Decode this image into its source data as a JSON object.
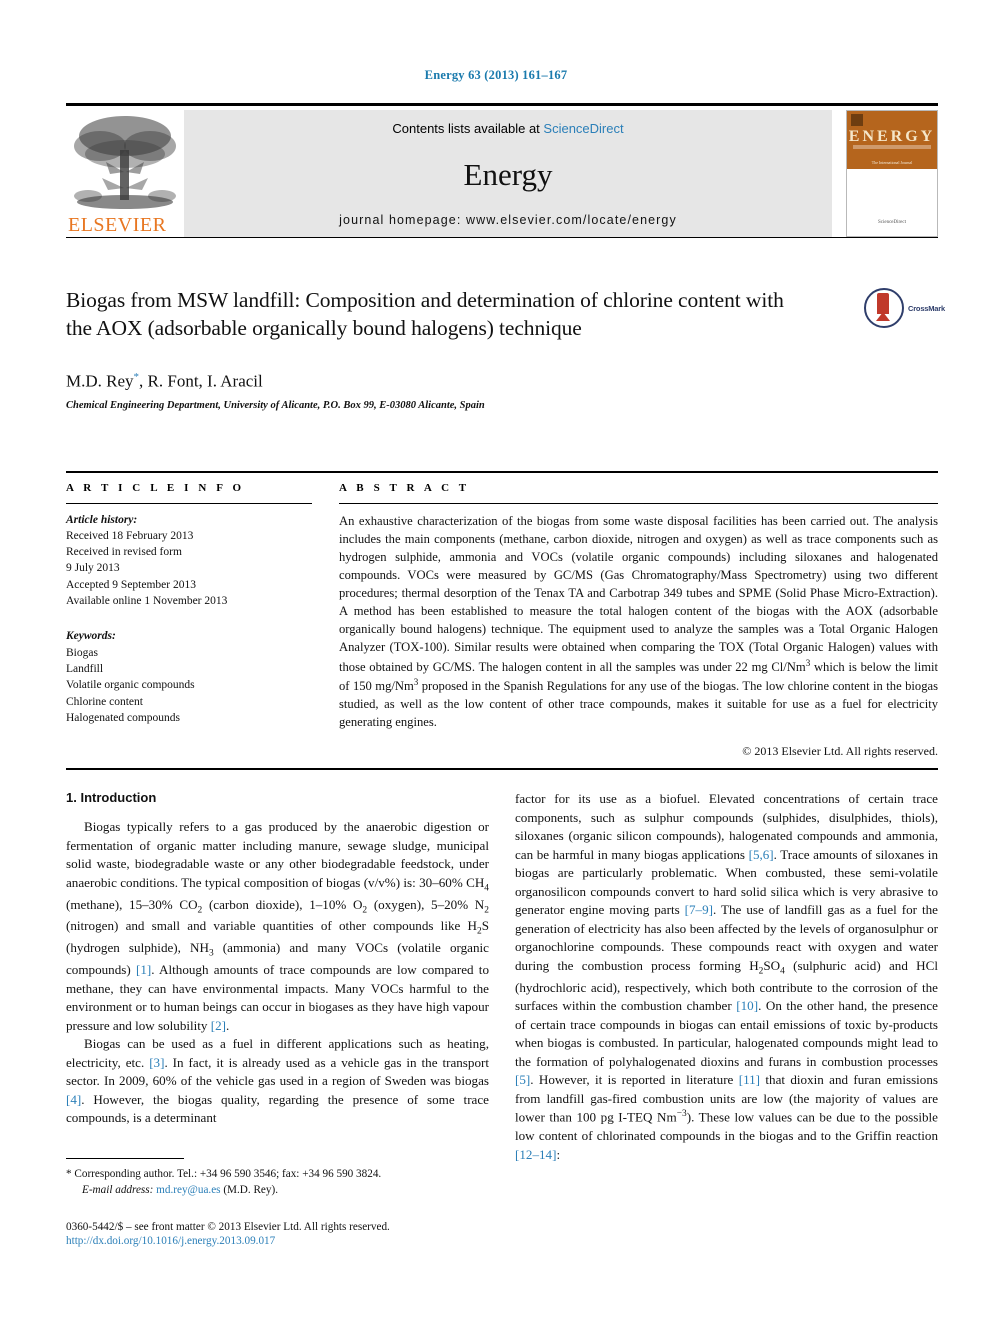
{
  "running_head": "Energy 63 (2013) 161–167",
  "masthead": {
    "contents_prefix": "Contents lists available at ",
    "sciencedirect_link": "ScienceDirect",
    "journal_name": "Energy",
    "homepage": "journal homepage: www.elsevier.com/locate/energy",
    "publisher_wordmark": "ELSEVIER",
    "cover_title": "ENERGY",
    "cover_subtitle": "The International Journal"
  },
  "article": {
    "title": "Biogas from MSW landfill: Composition and determination of chlorine content with the AOX (adsorbable organically bound halogens) technique",
    "authors": "M.D. Rey",
    "authors_rest": ", R. Font, I. Aracil",
    "author_mark": "*",
    "affiliation": "Chemical Engineering Department, University of Alicante, P.O. Box 99, E-03080 Alicante, Spain",
    "crossmark_label": "CrossMark"
  },
  "article_info": {
    "heading": "A R T I C L E  I N F O",
    "history_label": "Article history:",
    "history": [
      "Received 18 February 2013",
      "Received in revised form",
      "9 July 2013",
      "Accepted 9 September 2013",
      "Available online 1 November 2013"
    ],
    "keywords_label": "Keywords:",
    "keywords": [
      "Biogas",
      "Landfill",
      "Volatile organic compounds",
      "Chlorine content",
      "Halogenated compounds"
    ]
  },
  "abstract": {
    "heading": "A B S T R A C T",
    "paragraphs": [
      "An exhaustive characterization of the biogas from some waste disposal facilities has been carried out. The analysis includes the main components (methane, carbon dioxide, nitrogen and oxygen) as well as trace components such as hydrogen sulphide, ammonia and VOCs (volatile organic compounds) including siloxanes and halogenated compounds. VOCs were measured by GC/MS (Gas Chromatography/Mass Spectrometry) using two different procedures; thermal desorption of the Tenax TA and Carbotrap 349 tubes and SPME (Solid Phase Micro-Extraction). A method has been established to measure the total halogen content of the biogas with the AOX (adsorbable organically bound halogens) technique. The equipment used to analyze the samples was a Total Organic Halogen Analyzer (TOX-100). Similar results were obtained when comparing the TOX (Total Organic Halogen) values with those obtained by GC/MS. The halogen content in all the samples was under 22 mg Cl/Nm",
      " which is below the limit of 150 mg/Nm",
      " proposed in the Spanish Regulations for any use of the biogas. The low chlorine content in the biogas studied, as well as the low content of other trace compounds, makes it suitable for use as a fuel for electricity generating engines."
    ],
    "copyright": "© 2013 Elsevier Ltd. All rights reserved."
  },
  "introduction": {
    "section_number_title": "1.  Introduction",
    "left_col": {
      "p1_a": "Biogas typically refers to a gas produced by the anaerobic digestion or fermentation of organic matter including manure, sewage sludge, municipal solid waste, biodegradable waste or any other biodegradable feedstock, under anaerobic conditions. The typical composition of biogas (v/v%) is: 30–60% CH",
      "p1_b": " (methane), 15–30% CO",
      "p1_c": " (carbon dioxide), 1–10% O",
      "p1_d": " (oxygen), 5–20% N",
      "p1_e": " (nitrogen) and small and variable quantities of other compounds like H",
      "p1_f": "S (hydrogen sulphide), NH",
      "p1_g": " (ammonia) and many VOCs (volatile organic compounds) ",
      "p1_ref1": "[1]",
      "p1_h": ". Although amounts of trace compounds are low compared to methane, they can have environmental impacts. Many VOCs harmful to the environment or to human beings can occur in biogases as they have high vapour pressure and low solubility ",
      "p1_ref2": "[2]",
      "p1_i": ".",
      "p2_a": "Biogas can be used as a fuel in different applications such as heating, electricity, etc. ",
      "p2_ref3": "[3]",
      "p2_b": ". In fact, it is already used as a vehicle gas in the transport sector. In 2009, 60% of the vehicle gas used in a region of Sweden was biogas ",
      "p2_ref4": "[4]",
      "p2_c": ". However, the biogas quality, regarding the presence of some trace compounds, is a determinant"
    },
    "right_col": {
      "p_a": "factor for its use as a biofuel. Elevated concentrations of certain trace components, such as sulphur compounds (sulphides, disulphides, thiols), siloxanes (organic silicon compounds), halogenated compounds and ammonia, can be harmful in many biogas applications ",
      "p_ref56": "[5,6]",
      "p_b": ". Trace amounts of siloxanes in biogas are particularly problematic. When combusted, these semi-volatile organosilicon compounds convert to hard solid silica which is very abrasive to generator engine moving parts ",
      "p_ref79": "[7–9]",
      "p_c": ". The use of landfill gas as a fuel for the generation of electricity has also been affected by the levels of organosulphur or organochlorine compounds. These compounds react with oxygen and water during the combustion process forming H",
      "p_d": "SO",
      "p_e": " (sulphuric acid) and HCl (hydrochloric acid), respectively, which both contribute to the corrosion of the surfaces within the combustion chamber ",
      "p_ref10": "[10]",
      "p_f": ". On the other hand, the presence of certain trace compounds in biogas can entail emissions of toxic by-products when biogas is combusted. In particular, halogenated compounds might lead to the formation of polyhalogenated dioxins and furans in combustion processes ",
      "p_ref5": "[5]",
      "p_g": ". However, it is reported in literature ",
      "p_ref11": "[11]",
      "p_h": " that dioxin and furan emissions from landfill gas-fired combustion units are low (the majority of values are lower than 100 pg I-TEQ Nm",
      "p_i": "). These low values can be due to the possible low content of chlorinated compounds in the biogas and to the Griffin reaction ",
      "p_ref1214": "[12–14]",
      "p_j": ":"
    }
  },
  "footnote": {
    "star": "*",
    "corresponding": " Corresponding author. Tel.: +34 96 590 3546; fax: +34 96 590 3824.",
    "email_label": "E-mail address:",
    "email": "md.rey@ua.es",
    "email_owner": " (M.D. Rey)."
  },
  "footer": {
    "issn_line": "0360-5442/$ – see front matter © 2013 Elsevier Ltd. All rights reserved.",
    "doi": "http://dx.doi.org/10.1016/j.energy.2013.09.017"
  },
  "superscripts": {
    "ch4": "4",
    "co2": "2",
    "o2": "2",
    "n2": "2",
    "h2": "2",
    "nh3": "3",
    "nm3": "3",
    "so4": "4",
    "nm_minus3": "−3"
  },
  "colors": {
    "link_blue": "#2b7fb8",
    "header_blue": "#1a7aad",
    "elsevier_orange": "#E87722",
    "masthead_gray": "#e6e6e6",
    "cover_brown": "#b5651d"
  }
}
